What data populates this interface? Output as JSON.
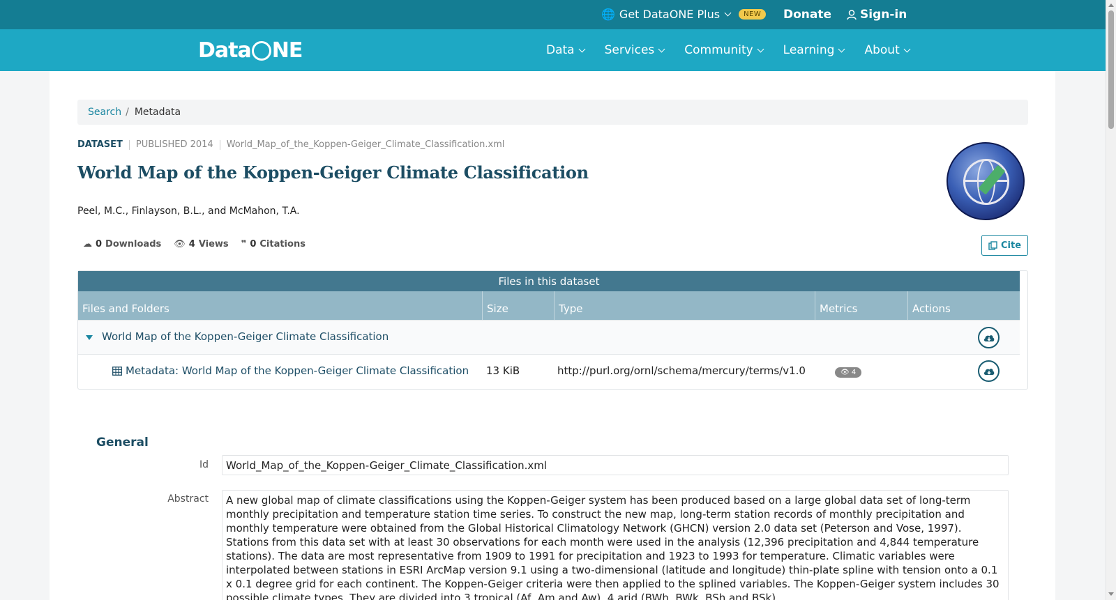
{
  "topbar": {
    "plus_label": "Get DataONE Plus",
    "plus_badge": "NEW",
    "donate_label": "Donate",
    "signin_label": "Sign-in"
  },
  "navbar": {
    "logo_left": "Data",
    "logo_right": "NE",
    "items": [
      {
        "label": "Data"
      },
      {
        "label": "Services"
      },
      {
        "label": "Community"
      },
      {
        "label": "Learning"
      },
      {
        "label": "About"
      }
    ]
  },
  "breadcrumb": {
    "search": "Search",
    "sep": "/",
    "current": "Metadata"
  },
  "dataset": {
    "type": "DATASET",
    "published": "PUBLISHED 2014",
    "filename": "World_Map_of_the_Koppen-Geiger_Climate_Classification.xml",
    "title": "World Map of the Koppen-Geiger Climate Classification",
    "authors": "Peel, M.C., Finlayson, B.L., and McMahon, T.A."
  },
  "stats": {
    "downloads_count": "0",
    "downloads_label": "Downloads",
    "views_count": "4",
    "views_label": "Views",
    "citations_count": "0",
    "citations_label": "Citations"
  },
  "cite_label": "Cite",
  "files": {
    "caption": "Files in this dataset",
    "columns": [
      "Files and Folders",
      "Size",
      "Type",
      "Metrics",
      "Actions"
    ],
    "package_name": "World Map of the Koppen-Geiger Climate Classification",
    "rows": [
      {
        "name": "Metadata: World Map of the Koppen-Geiger Climate Classification",
        "size": "13 KiB",
        "type": "http://purl.org/ornl/schema/mercury/terms/v1.0",
        "views": "4"
      }
    ]
  },
  "general": {
    "title": "General",
    "id_label": "Id",
    "id_value": "World_Map_of_the_Koppen-Geiger_Climate_Classification.xml",
    "abstract_label": "Abstract",
    "abstract_value": "A new global map of climate classifications using the Koppen-Geiger system has been produced based on a large global data set of long-term monthly precipitation and temperature station time series. To construct the new map, long-term station records of monthly precipitation and monthly temperature were obtained from the Global Historical Climatology Network (GHCN) version 2.0 data set (Peterson and Vose, 1997). Stations from this data set with at least 30 observations for each month were used in the analysis (12,396 precipitation and 4,844 temperature stations). The data are most representative from 1909 to 1991 for precipitation and 1923 to 1993 for temperature. Climatic variables were interpolated between stations in ESRI ArcMap version 9.1 using a two-dimensional (latitude and longitude) thin-plate spline with tension onto a 0.1 x 0.1 degree grid for each continent. The Koppen-Geiger criteria were then applied to the splined variables. The Koppen-Geiger system includes 30 possible climate types. They are divided into 3 tropical (Af, Am and Aw), 4 arid (BWh, BWk, BSh and BSk)"
  },
  "colors": {
    "topbar": "#147d93",
    "navbar": "#1ea8c4",
    "table_caption": "#43788f",
    "table_head": "#93b7c6",
    "link": "#1a86a0"
  }
}
